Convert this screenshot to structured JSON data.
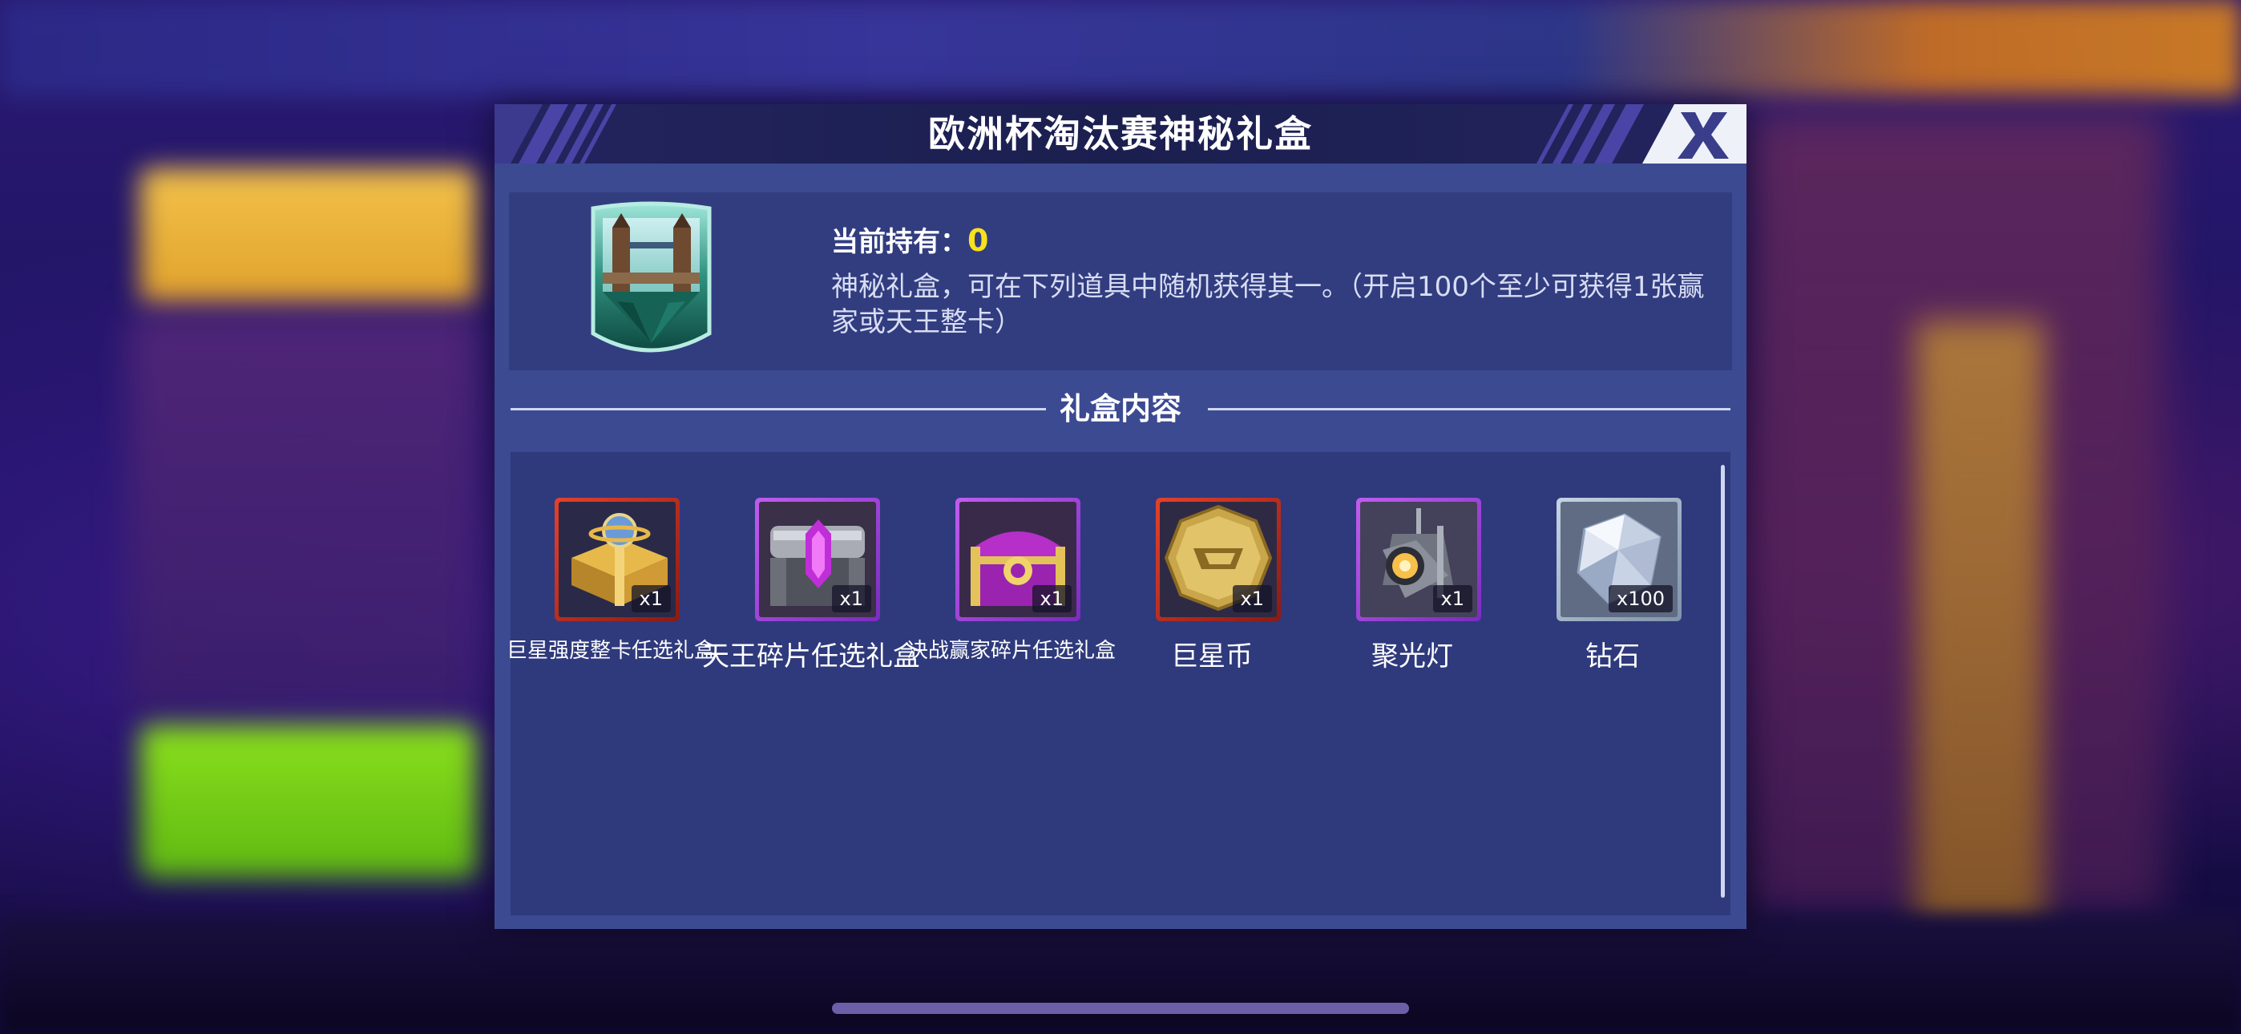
{
  "dialog": {
    "title": "欧洲杯淘汰赛神秘礼盒",
    "close_label": "X"
  },
  "info": {
    "holding_label": "当前持有：",
    "holding_value": "0",
    "description": "神秘礼盒，可在下列道具中随机获得其一。（开启100个至少可获得1张赢家或天王整卡）"
  },
  "section": {
    "title": "礼盒内容"
  },
  "rewards": [
    {
      "name": "巨星强度整卡任选礼盒",
      "qty": "x1",
      "frame": "red",
      "icon": "gold-gift-box-icon"
    },
    {
      "name": "天王碎片任选礼盒",
      "qty": "x1",
      "frame": "purple",
      "icon": "silver-chest-icon"
    },
    {
      "name": "决战赢家碎片任选礼盒",
      "qty": "x1",
      "frame": "purple",
      "icon": "purple-chest-icon"
    },
    {
      "name": "巨星币",
      "qty": "x1",
      "frame": "red",
      "icon": "gold-coin-icon"
    },
    {
      "name": "聚光灯",
      "qty": "x1",
      "frame": "purple",
      "icon": "spotlight-icon"
    },
    {
      "name": "钻石",
      "qty": "x100",
      "frame": "silver",
      "icon": "diamond-icon"
    }
  ],
  "colors": {
    "dialog_bg": "#3c4a92",
    "header_bg": "#1b1f4f",
    "holding_value": "#f7e21b"
  }
}
